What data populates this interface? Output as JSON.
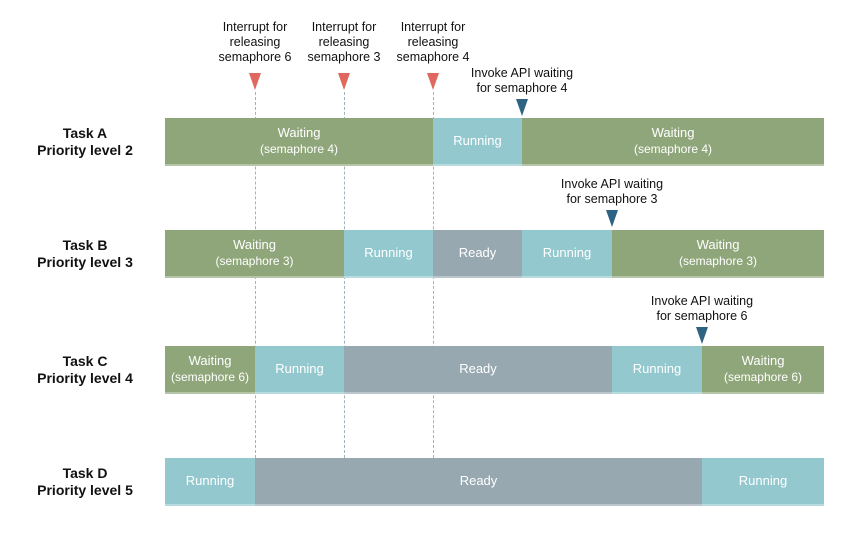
{
  "colors": {
    "waiting": "#8fa67a",
    "running": "#93c8cf",
    "ready": "#97a8b1",
    "interrupt_marker": "#e0675e",
    "api_marker": "#2f6383"
  },
  "interrupts": [
    {
      "label": "Interrupt for releasing semaphore 6",
      "lines": [
        "Interrupt for",
        "releasing",
        "semaphore 6"
      ]
    },
    {
      "label": "Interrupt for releasing semaphore 3",
      "lines": [
        "Interrupt for",
        "releasing",
        "semaphore 3"
      ]
    },
    {
      "label": "Interrupt for releasing semaphore 4",
      "lines": [
        "Interrupt for",
        "releasing",
        "semaphore 4"
      ]
    }
  ],
  "api_calls": [
    {
      "lines": [
        "Invoke API waiting",
        "for semaphore 4"
      ]
    },
    {
      "lines": [
        "Invoke API waiting",
        "for semaphore 3"
      ]
    },
    {
      "lines": [
        "Invoke API waiting",
        "for semaphore 6"
      ]
    }
  ],
  "tasks": [
    {
      "name": "Task A",
      "priority": "Priority level 2",
      "segments": [
        {
          "state": "waiting",
          "label": "Waiting",
          "sub": "(semaphore 4)"
        },
        {
          "state": "running",
          "label": "Running"
        },
        {
          "state": "waiting",
          "label": "Waiting",
          "sub": "(semaphore 4)"
        }
      ]
    },
    {
      "name": "Task B",
      "priority": "Priority level 3",
      "segments": [
        {
          "state": "waiting",
          "label": "Waiting",
          "sub": "(semaphore 3)"
        },
        {
          "state": "running",
          "label": "Running"
        },
        {
          "state": "ready",
          "label": "Ready"
        },
        {
          "state": "running",
          "label": "Running"
        },
        {
          "state": "waiting",
          "label": "Waiting",
          "sub": "(semaphore 3)"
        }
      ]
    },
    {
      "name": "Task C",
      "priority": "Priority level 4",
      "segments": [
        {
          "state": "waiting",
          "label": "Waiting",
          "sub": "(semaphore 6)"
        },
        {
          "state": "running",
          "label": "Running"
        },
        {
          "state": "ready",
          "label": "Ready"
        },
        {
          "state": "running",
          "label": "Running"
        },
        {
          "state": "waiting",
          "label": "Waiting",
          "sub": "(semaphore 6)"
        }
      ]
    },
    {
      "name": "Task D",
      "priority": "Priority level 5",
      "segments": [
        {
          "state": "running",
          "label": "Running"
        },
        {
          "state": "ready",
          "label": "Ready"
        },
        {
          "state": "running",
          "label": "Running"
        }
      ]
    }
  ]
}
